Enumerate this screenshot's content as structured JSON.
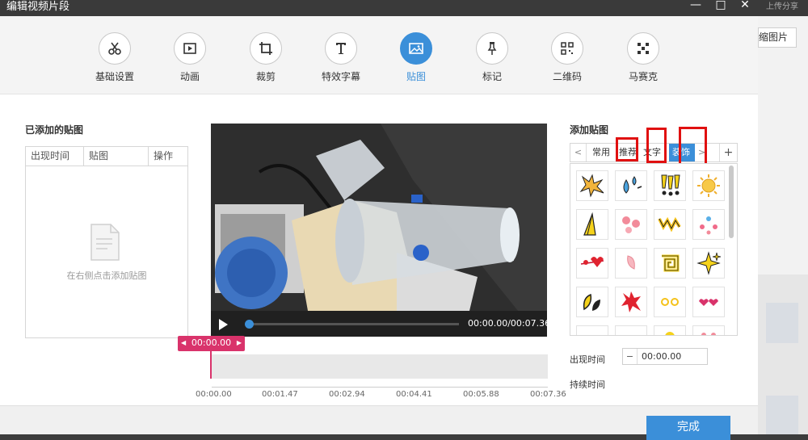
{
  "window": {
    "title": "编辑视频片段",
    "min": "—",
    "max": "□",
    "close": "✕"
  },
  "background": {
    "upload_text": "上传分享",
    "thumb_button": "缩图片"
  },
  "toolbar": {
    "items": [
      {
        "label": "基础设置",
        "icon": "scissors-icon"
      },
      {
        "label": "动画",
        "icon": "animation-icon"
      },
      {
        "label": "裁剪",
        "icon": "crop-icon"
      },
      {
        "label": "特效字幕",
        "icon": "text-icon"
      },
      {
        "label": "贴图",
        "icon": "image-icon"
      },
      {
        "label": "标记",
        "icon": "pin-icon"
      },
      {
        "label": "二维码",
        "icon": "qrcode-icon"
      },
      {
        "label": "马赛克",
        "icon": "mosaic-icon"
      }
    ],
    "active": "贴图"
  },
  "added_stickers": {
    "title": "已添加的贴图",
    "columns": [
      "出现时间",
      "贴图",
      "操作"
    ],
    "empty_text": "在右侧点击添加贴图"
  },
  "player": {
    "timecode": "00:00.00/00:07.36",
    "progress": 0.0
  },
  "timeline": {
    "playhead": "00:00.00",
    "ticks": [
      "00:00.00",
      "00:01.47",
      "00:02.94",
      "00:04.41",
      "00:05.88",
      "00:07.36"
    ]
  },
  "add_sticker": {
    "title": "添加贴图",
    "tabs": [
      "常用",
      "推荐",
      "文字",
      "装饰"
    ],
    "active_tab": "装饰",
    "prev": "<",
    "next": ">",
    "add": "+"
  },
  "fields": {
    "appear_label": "出现时间",
    "appear_minus": "−",
    "appear_value": "00:00.00",
    "duration_label": "持续时间"
  },
  "footer": {
    "done": "完成"
  },
  "colors": {
    "accent": "#3b8fd9",
    "playhead": "#d9336b",
    "highlight": "#e01010"
  }
}
